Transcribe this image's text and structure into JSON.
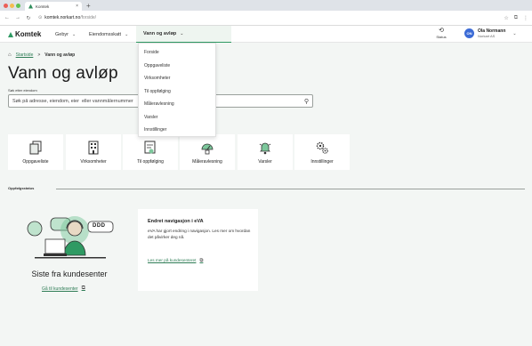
{
  "browser": {
    "tab_title": "Komtek",
    "tab_close": "×",
    "new_tab": "+",
    "url_host": "komtek.norkart.no",
    "url_path": "/forside/"
  },
  "header": {
    "logo": "Komtek",
    "nav": [
      {
        "label": "Gebyr"
      },
      {
        "label": "Eiendomsskatt"
      },
      {
        "label": "Vann og avløp"
      }
    ],
    "status_label": "Status",
    "user": {
      "initials": "ON",
      "name": "Ola Normann",
      "org": "Norkart AS"
    }
  },
  "dropdown": {
    "items": [
      "Forside",
      "Oppgaveliste",
      "Virksomheter",
      "Til oppfølging",
      "Måleravlesning",
      "Varsler",
      "Innstillinger"
    ]
  },
  "breadcrumb": {
    "home": "Startside",
    "separator": ">",
    "current": "Vann og avløp"
  },
  "page": {
    "title": "Vann og avløp",
    "search_label": "Søk etter eiendom",
    "search_placeholder": "Søk på adresse, eiendom, eier  eller vannmålernummer"
  },
  "tiles": [
    {
      "label": "Oppgaveliste",
      "icon": "copy-icon"
    },
    {
      "label": "Virksomheter",
      "icon": "building-icon"
    },
    {
      "label": "Til oppfølging",
      "icon": "note-icon"
    },
    {
      "label": "Måleravlesning",
      "icon": "meter-icon"
    },
    {
      "label": "Varsler",
      "icon": "bell-icon"
    },
    {
      "label": "Innstillinger",
      "icon": "gears-icon"
    }
  ],
  "section": {
    "title": "Oppfølgsstatus"
  },
  "kundesenter": {
    "title": "Siste fra kundesenter",
    "link": "Gå til kundesenter",
    "bubble_text": "DDD"
  },
  "news": {
    "title": "Endret navigasjon i eVA",
    "body": "eVA har gjort endring i navigasjon. Les mer om hvordan det påvirker deg nå.",
    "link": "Les mer på kundesenteret"
  },
  "colors": {
    "brand": "#2f9a63",
    "link": "#2f7d56",
    "avatar": "#3b6bd6",
    "page_bg": "#f3f6f4"
  }
}
